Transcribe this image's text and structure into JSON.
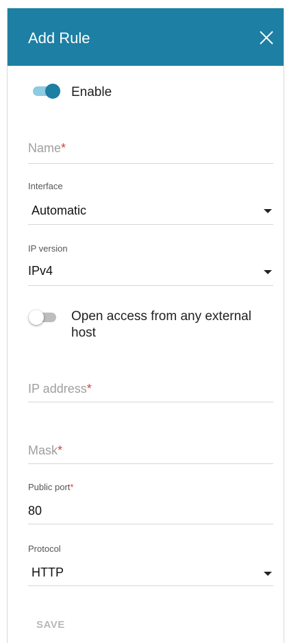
{
  "dialog": {
    "title": "Add Rule",
    "close_icon": "close-icon"
  },
  "enable": {
    "label": "Enable",
    "on": true
  },
  "name": {
    "placeholder": "Name",
    "required_mark": "*",
    "value": ""
  },
  "interface": {
    "label": "Interface",
    "value": "Automatic",
    "icon": "caret-down-icon"
  },
  "ip_version": {
    "label": "IP version",
    "value": "IPv4",
    "icon": "caret-down-icon"
  },
  "open_access": {
    "label_line1": "Open access from any external",
    "label_line2": "host",
    "on": false
  },
  "ip_address": {
    "placeholder": "IP address",
    "required_mark": "*",
    "value": ""
  },
  "mask": {
    "placeholder": "Mask",
    "required_mark": "*",
    "value": ""
  },
  "public_port": {
    "label": "Public port",
    "required_mark": "*",
    "value": "80"
  },
  "protocol": {
    "label": "Protocol",
    "value": "HTTP",
    "icon": "caret-down-icon"
  },
  "actions": {
    "save_label": "SAVE"
  },
  "colors": {
    "header": "#1c7fa3",
    "toggle_on": "#1c7fa3",
    "required": "#e03a3a",
    "save_disabled": "#b8b8b8"
  }
}
